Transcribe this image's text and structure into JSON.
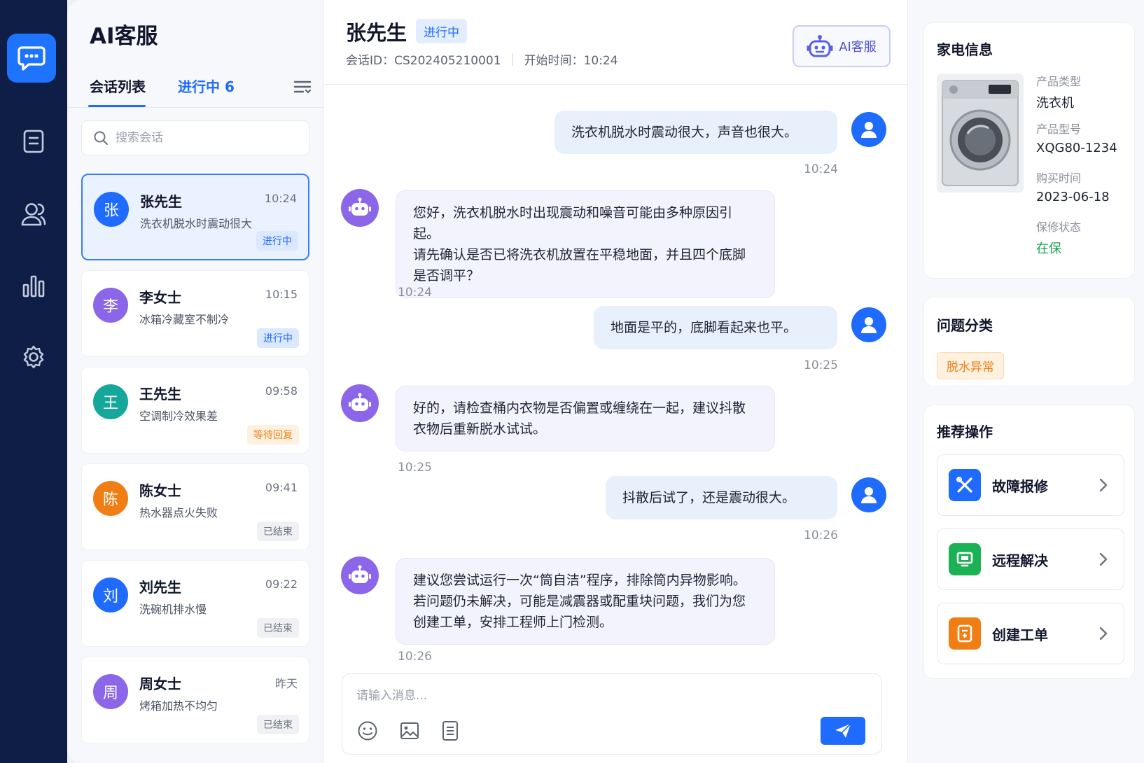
{
  "app": {
    "title": "AI客服"
  },
  "colors": {
    "primary": "#1f6bff",
    "rail": "#0f1e46",
    "bot": "#8b66e8",
    "success": "#17a34a",
    "warning": "#f07e15"
  },
  "rail": {
    "items": [
      {
        "icon": "chat-icon",
        "active": true
      },
      {
        "icon": "document-icon"
      },
      {
        "icon": "users-icon"
      },
      {
        "icon": "bar-chart-icon"
      },
      {
        "icon": "gear-icon"
      }
    ]
  },
  "list": {
    "tab_conversations": "会话列表",
    "tab_active": "进行中 6",
    "search_placeholder": "搜索会话",
    "conversations": [
      {
        "avatar": "张",
        "name": "张先生",
        "time": "10:24",
        "preview": "洗衣机脱水时震动很大",
        "status": "进行中",
        "color": "#1f6bff"
      },
      {
        "avatar": "李",
        "name": "李女士",
        "time": "10:15",
        "preview": "冰箱冷藏室不制冷",
        "status": "进行中",
        "color": "#8b66e8"
      },
      {
        "avatar": "王",
        "name": "王先生",
        "time": "09:58",
        "preview": "空调制冷效果差",
        "status": "等待回复",
        "color": "#16a79b"
      },
      {
        "avatar": "陈",
        "name": "陈女士",
        "time": "09:41",
        "preview": "热水器点火失败",
        "status": "已结束",
        "color": "#f07e15"
      },
      {
        "avatar": "刘",
        "name": "刘先生",
        "time": "09:22",
        "preview": "洗碗机排水慢",
        "status": "已结束",
        "color": "#1f6bff"
      },
      {
        "avatar": "周",
        "name": "周女士",
        "time": "昨天",
        "preview": "烤箱加热不均匀",
        "status": "已结束",
        "color": "#8b66e8"
      }
    ]
  },
  "chat": {
    "customer": "张先生",
    "status": "进行中",
    "session_label": "会话ID：",
    "session_id": "CS202405210001",
    "start_label": "开始时间：",
    "start_time": "10:24",
    "ai_button": "AI客服",
    "messages": [
      {
        "from": "user",
        "lines": [
          "洗衣机脱水时震动很大，声音也很大。"
        ],
        "time": "10:24"
      },
      {
        "from": "bot",
        "lines": [
          "您好，洗衣机脱水时出现震动和噪音可能由多种原因引起。",
          "请先确认是否已将洗衣机放置在平稳地面，并且四个底脚",
          "是否调平？"
        ],
        "time": "10:24"
      },
      {
        "from": "user",
        "lines": [
          "地面是平的，底脚看起来也平。"
        ],
        "time": "10:25"
      },
      {
        "from": "bot",
        "lines": [
          "好的，请检查桶内衣物是否偏置或缠绕在一起，建议抖散",
          "衣物后重新脱水试试。"
        ],
        "time": "10:25"
      },
      {
        "from": "user",
        "lines": [
          "抖散后试了，还是震动很大。"
        ],
        "time": "10:26"
      },
      {
        "from": "bot",
        "lines": [
          "建议您尝试运行一次“筒自洁”程序，排除筒内异物影响。",
          "若问题仍未解决，可能是减震器或配重块问题，我们为您",
          "创建工单，安排工程师上门检测。"
        ],
        "time": "10:26"
      }
    ],
    "input_placeholder": "请输入消息..."
  },
  "side": {
    "appliance": {
      "title": "家电信息",
      "type_label": "产品类型",
      "type": "洗衣机",
      "model_label": "产品型号",
      "model": "XQG80-1234",
      "purchase_label": "购买时间",
      "purchase": "2023-06-18",
      "warranty_label": "保修状态",
      "warranty": "在保"
    },
    "category": {
      "title": "问题分类",
      "tag": "脱水异常"
    },
    "actions": {
      "title": "推荐操作",
      "items": [
        {
          "label": "故障报修",
          "icon": "wrench-icon",
          "color": "#1f6bff"
        },
        {
          "label": "远程解决",
          "icon": "monitor-icon",
          "color": "#1bb256"
        },
        {
          "label": "创建工单",
          "icon": "ticket-icon",
          "color": "#f07e15"
        }
      ]
    }
  }
}
